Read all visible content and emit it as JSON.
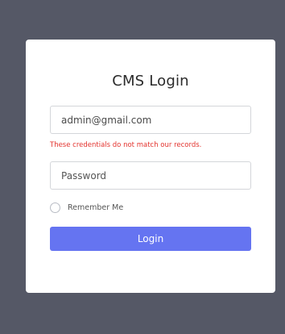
{
  "login": {
    "title": "CMS Login",
    "email_value": "admin@gmail.com",
    "error_message": "These credentials do not match our records.",
    "password_placeholder": "Password",
    "remember_label": "Remember Me",
    "login_label": "Login"
  },
  "colors": {
    "background": "#555866",
    "card": "#ffffff",
    "accent_button": "#6574f1",
    "error": "#e3342f"
  },
  "icons": {
    "remember_checkbox": "checkbox-unchecked-icon"
  }
}
